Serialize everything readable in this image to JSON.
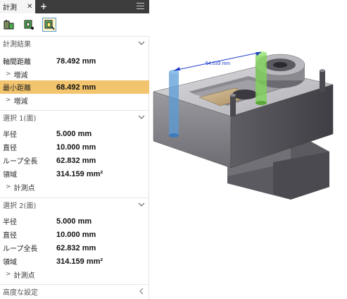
{
  "tab": {
    "label": "計測",
    "close": "✕",
    "add": "+"
  },
  "sections": {
    "result": "計測結果",
    "selection1": "選択 1(面)",
    "selection2": "選択 2(面)",
    "advanced": "高度な設定"
  },
  "result": {
    "axis_distance": {
      "label": "軸間距離",
      "value": "78.492 mm"
    },
    "increment1": "増減",
    "min_distance": {
      "label": "最小距離",
      "value": "68.492 mm"
    },
    "increment2": "増減"
  },
  "selection1": {
    "radius": {
      "label": "半径",
      "value": "5.000 mm"
    },
    "diameter": {
      "label": "直径",
      "value": "10.000 mm"
    },
    "loop": {
      "label": "ループ全長",
      "value": "62.832 mm"
    },
    "area": {
      "label": "領域",
      "value": "314.159 mm²"
    },
    "points": "計測点"
  },
  "selection2": {
    "radius": {
      "label": "半径",
      "value": "5.000 mm"
    },
    "diameter": {
      "label": "直径",
      "value": "10.000 mm"
    },
    "loop": {
      "label": "ループ全長",
      "value": "62.832 mm"
    },
    "area": {
      "label": "領域",
      "value": "314.159 mm²"
    },
    "points": "計測点"
  },
  "viewport": {
    "dimension_label": "54.033 mm"
  },
  "colors": {
    "highlight": "#f2c46e",
    "selection_blue": "#5b9bd5",
    "selection_green": "#7ed35a",
    "dimension": "#1f3cc9"
  }
}
